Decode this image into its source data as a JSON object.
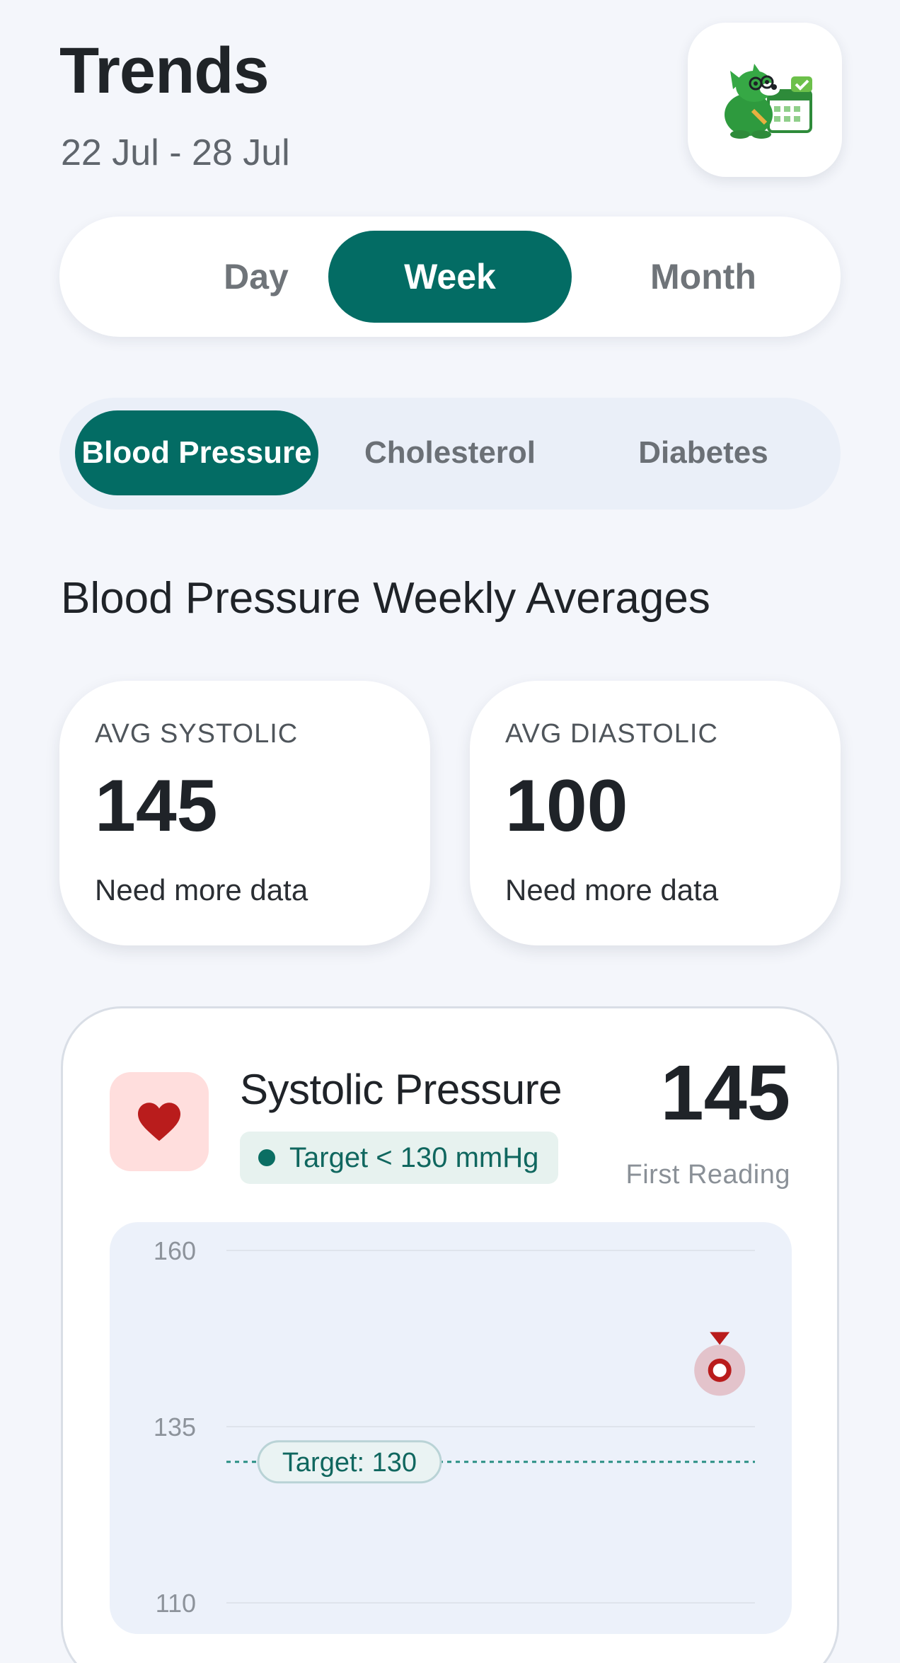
{
  "header": {
    "title": "Trends",
    "date_range": "22 Jul - 28 Jul",
    "mascot_icon": "mascot-calendar-icon"
  },
  "period_tabs": [
    {
      "label": "Day",
      "active": false
    },
    {
      "label": "Week",
      "active": true
    },
    {
      "label": "Month",
      "active": false
    }
  ],
  "category_tabs": [
    {
      "label": "Blood Pressure",
      "active": true
    },
    {
      "label": "Cholesterol",
      "active": false
    },
    {
      "label": "Diabetes",
      "active": false
    }
  ],
  "section_title": "Blood Pressure Weekly Averages",
  "averages": [
    {
      "label": "AVG SYSTOLIC",
      "value": "145",
      "note": "Need more data"
    },
    {
      "label": "AVG DIASTOLIC",
      "value": "100",
      "note": "Need more data"
    }
  ],
  "systolic_card": {
    "icon": "heart-icon",
    "title": "Systolic Pressure",
    "target_text": "Target < 130 mmHg",
    "value": "145",
    "value_caption": "First Reading"
  },
  "colors": {
    "accent": "#036c64",
    "background": "#f4f6fb",
    "heart": "#b91c1c",
    "heart_bg": "#ffdedd",
    "target_line": "#2a8f84",
    "chart_bg": "#ecf1fa"
  },
  "chart_data": {
    "type": "scatter",
    "ylim": [
      110,
      160
    ],
    "yticks": [
      160,
      135,
      110
    ],
    "xlim": [
      0,
      6
    ],
    "points": [
      {
        "x": 5.6,
        "y": 143
      }
    ],
    "target": {
      "value": 130,
      "label": "Target: 130"
    },
    "grid": true
  }
}
